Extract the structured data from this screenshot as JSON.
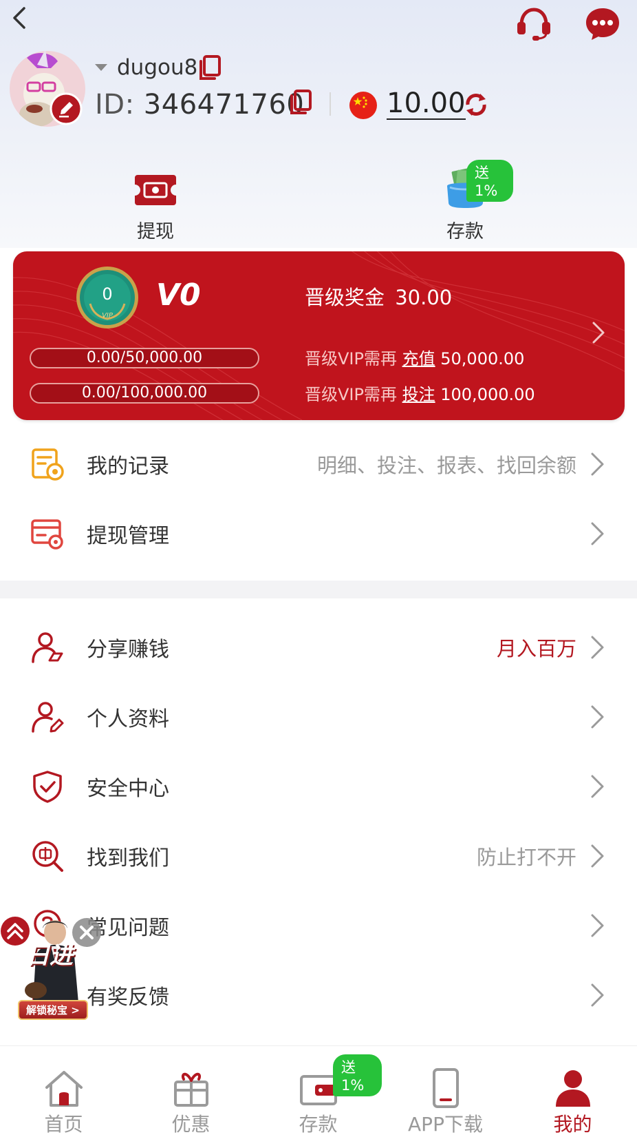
{
  "header": {
    "back_icon": "chevron-left-icon",
    "support_icon": "headset-icon",
    "chat_icon": "chat-bubble-icon"
  },
  "profile": {
    "username": "dugou8",
    "id_label": "ID:",
    "id_value": "346471760",
    "currency_flag": "china-flag-icon",
    "balance": "10.00"
  },
  "quick_actions": {
    "withdraw_label": "提现",
    "deposit_label": "存款",
    "deposit_badge": "送1%"
  },
  "vip": {
    "medal_level": "0",
    "medal_sub": "VIP",
    "level_name": "V0",
    "bonus_label": "晋级奖金",
    "bonus_value": "30.00",
    "progress_recharge": "0.00/50,000.00",
    "progress_bet": "0.00/100,000.00",
    "recharge_prefix": "晋级VIP需再",
    "recharge_link": "充值",
    "recharge_amount": "50,000.00",
    "bet_prefix": "晋级VIP需再",
    "bet_link": "投注",
    "bet_amount": "100,000.00"
  },
  "menu_group1": [
    {
      "label": "我的记录",
      "hint": "明细、投注、报表、找回余额",
      "icon": "records-icon"
    },
    {
      "label": "提现管理",
      "hint": "",
      "icon": "withdraw-manage-icon"
    }
  ],
  "menu_group2": [
    {
      "label": "分享赚钱",
      "hint": "月入百万",
      "icon": "share-earn-icon"
    },
    {
      "label": "个人资料",
      "hint": "",
      "icon": "profile-edit-icon"
    },
    {
      "label": "安全中心",
      "hint": "",
      "icon": "shield-check-icon"
    },
    {
      "label": "找到我们",
      "hint": "防止打不开",
      "icon": "find-us-icon"
    },
    {
      "label": "常见问题",
      "hint": "",
      "icon": "faq-icon"
    },
    {
      "label": "有奖反馈",
      "hint": "",
      "icon": "feedback-icon"
    }
  ],
  "floating_promo": {
    "title_text": "日进",
    "button_text": "解锁秘宝 >"
  },
  "tabbar": [
    {
      "label": "首页",
      "icon": "home-icon",
      "active": false
    },
    {
      "label": "优惠",
      "icon": "gift-icon",
      "active": false
    },
    {
      "label": "存款",
      "icon": "wallet-icon",
      "active": false,
      "badge": "送1%"
    },
    {
      "label": "APP下载",
      "icon": "phone-icon",
      "active": false
    },
    {
      "label": "我的",
      "icon": "user-icon",
      "active": true
    }
  ],
  "colors": {
    "brand_red": "#b31821",
    "card_red": "#c0141d",
    "badge_green": "#27c23a",
    "inactive_gray": "#9a9a9a"
  }
}
